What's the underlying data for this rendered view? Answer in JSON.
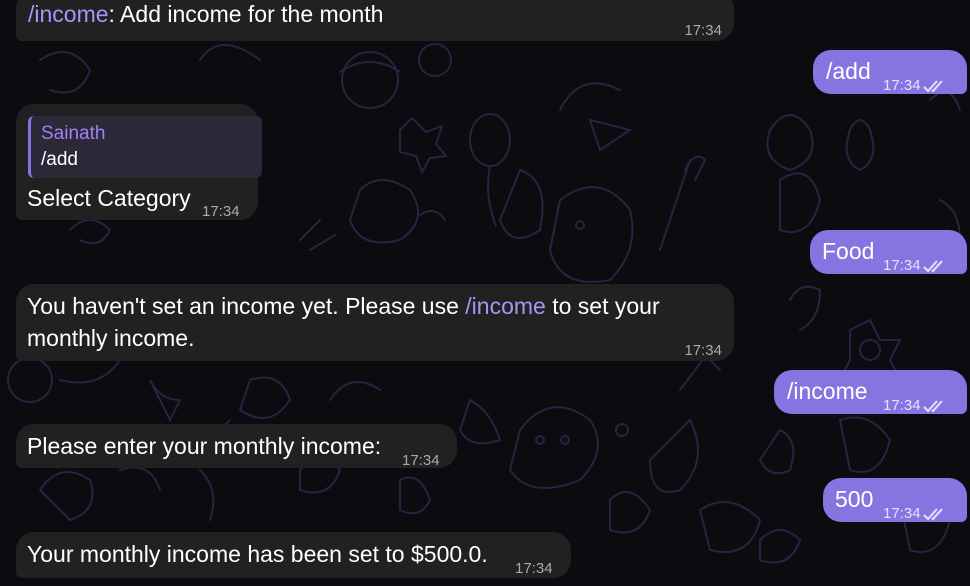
{
  "colors": {
    "background": "#0d0b10",
    "incoming_bubble": "#212121",
    "outgoing_bubble": "#8774e1",
    "link": "#a696f5"
  },
  "messages": [
    {
      "dir": "in",
      "command": "/income",
      "text": ": Add income for the month",
      "time": "17:34"
    },
    {
      "dir": "out",
      "text": "/add",
      "time": "17:34",
      "status": "read-double-check-icon"
    },
    {
      "dir": "in",
      "reply_name": "Sainath",
      "reply_text": "/add",
      "text": "Select Category",
      "time": "17:34"
    },
    {
      "dir": "out",
      "text": "Food",
      "time": "17:34",
      "status": "read-double-check-icon"
    },
    {
      "dir": "in",
      "text_before": "You haven't set an income yet. Please use ",
      "command": "/income",
      "text_after": " to set your",
      "text_line2": "monthly income.",
      "time": "17:34"
    },
    {
      "dir": "out",
      "text": "/income",
      "time": "17:34",
      "status": "read-double-check-icon"
    },
    {
      "dir": "in",
      "text": "Please enter your monthly income:",
      "time": "17:34"
    },
    {
      "dir": "out",
      "text": "500",
      "time": "17:34",
      "status": "read-double-check-icon"
    },
    {
      "dir": "in",
      "text": "Your monthly income has been set to $500.0.",
      "time": "17:34"
    }
  ]
}
